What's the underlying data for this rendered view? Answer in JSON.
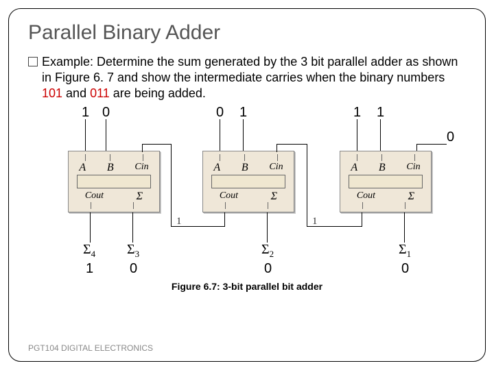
{
  "title": "Parallel Binary Adder",
  "example_label": "Example:",
  "example_body_pre": " Determine the sum generated by the 3 bit parallel adder as shown in Figure 6. 7 and show the intermediate carries when the binary numbers ",
  "num_a": "101",
  "example_body_mid": " and ",
  "num_b": "011",
  "example_body_post": " are being added.",
  "blocks": [
    {
      "labels": {
        "a": "A",
        "b": "B",
        "cin": "Cin",
        "cout": "Cout",
        "s": "Σ"
      }
    },
    {
      "labels": {
        "a": "A",
        "b": "B",
        "cin": "Cin",
        "cout": "Cout",
        "s": "Σ"
      }
    },
    {
      "labels": {
        "a": "A",
        "b": "B",
        "cin": "Cin",
        "cout": "Cout",
        "s": "Σ"
      }
    }
  ],
  "inputs": {
    "b3_a": "1",
    "b3_b": "0",
    "b2_a": "0",
    "b2_b": "1",
    "b1_a": "1",
    "b1_b": "1",
    "cin0": "0"
  },
  "carry_ones": {
    "c1": "1",
    "c2": "1"
  },
  "sigma_labels": {
    "s4": "Σ",
    "s4s": "4",
    "s3": "Σ",
    "s3s": "3",
    "s2": "Σ",
    "s2s": "2",
    "s1": "Σ",
    "s1s": "1"
  },
  "outputs": {
    "s4": "1",
    "s3": "0",
    "s2": "0",
    "s1": "0"
  },
  "caption": "Figure 6.7: 3-bit parallel bit adder",
  "footer": "PGT104 DIGITAL ELECTRONICS"
}
